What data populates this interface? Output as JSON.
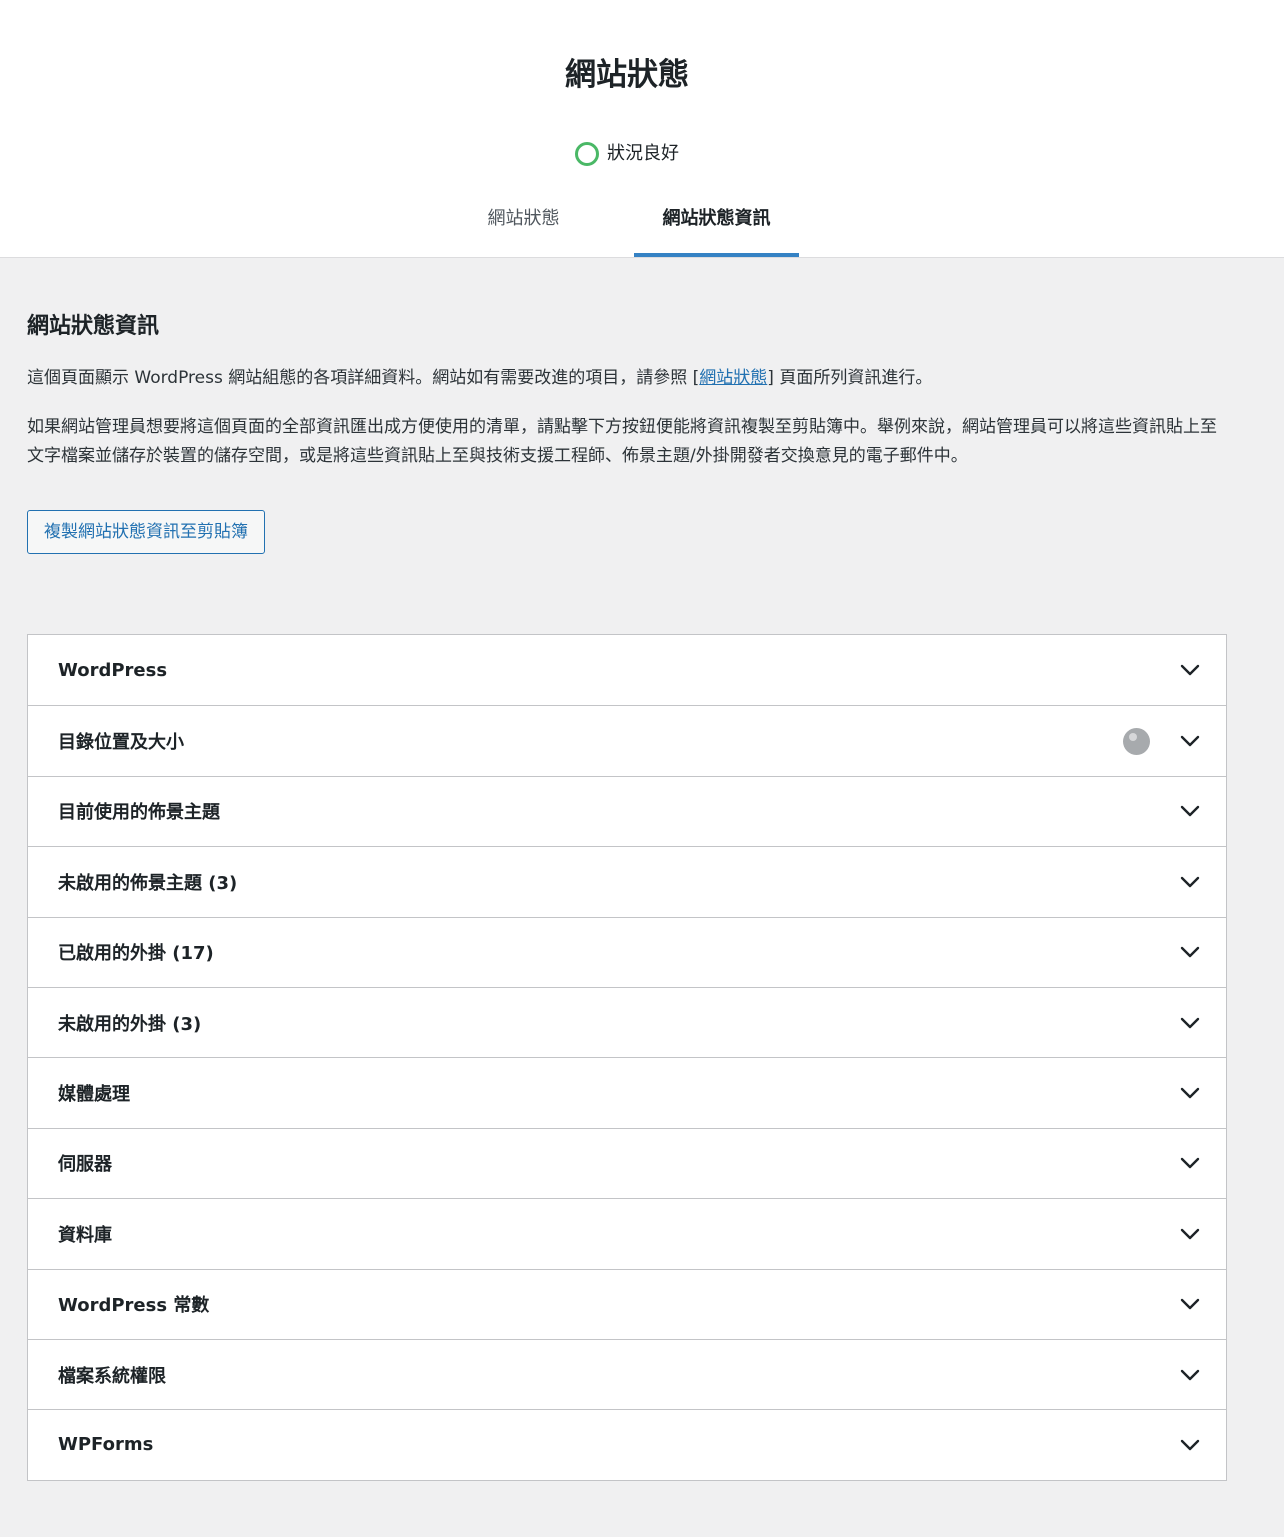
{
  "header": {
    "title": "網站狀態",
    "status_label": "狀況良好",
    "status_color": "#4ab866",
    "tabs": [
      {
        "label": "網站狀態",
        "active": false
      },
      {
        "label": "網站狀態資訊",
        "active": true
      }
    ],
    "active_tab_color": "#3582c4"
  },
  "main": {
    "section_title": "網站狀態資訊",
    "intro_before_link": "這個頁面顯示 WordPress 網站組態的各項詳細資料。網站如有需要改進的項目，請參照 [",
    "intro_link": "網站狀態",
    "intro_after_link": "] 頁面所列資訊進行。",
    "export_text": "如果網站管理員想要將這個頁面的全部資訊匯出成方便使用的清單，請點擊下方按鈕便能將資訊複製至剪貼簿中。舉例來說，網站管理員可以將這些資訊貼上至文字檔案並儲存於裝置的儲存空間，或是將這些資訊貼上至與技術支援工程師、佈景主題/外掛開發者交換意見的電子郵件中。",
    "copy_button_label": "複製網站狀態資訊至剪貼簿"
  },
  "accordion": {
    "items": [
      {
        "label": "WordPress"
      },
      {
        "label": "目錄位置及大小",
        "badge": "loading-indicator"
      },
      {
        "label": "目前使用的佈景主題"
      },
      {
        "label": "未啟用的佈景主題 (3)"
      },
      {
        "label": "已啟用的外掛 (17)"
      },
      {
        "label": "未啟用的外掛 (3)"
      },
      {
        "label": "媒體處理"
      },
      {
        "label": "伺服器"
      },
      {
        "label": "資料庫"
      },
      {
        "label": "WordPress 常數"
      },
      {
        "label": "檔案系統權限"
      },
      {
        "label": "WPForms"
      }
    ],
    "expand_icon": "chevron-down-icon"
  }
}
